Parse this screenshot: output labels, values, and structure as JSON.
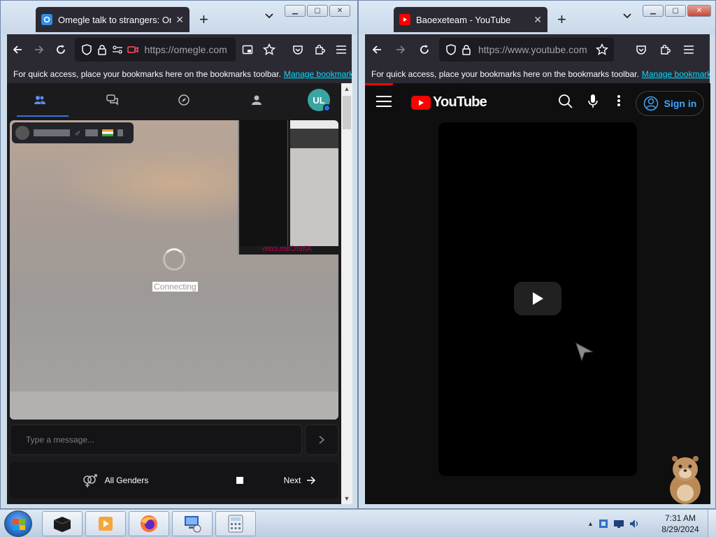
{
  "left_window": {
    "tab_title": "Omegle talk to strangers: Omegle",
    "url": "https://omegle.com",
    "bookmarks_text": "For quick access, place your bookmarks here on the bookmarks toolbar.",
    "manage_bookmarks": "Manage bookmarks",
    "omegle": {
      "avatar_initials": "UL",
      "connecting_text": "Connecting",
      "pip_watermark": "AlterCam.com",
      "message_placeholder": "Type a message...",
      "gender_label": "All Genders",
      "next_label": "Next"
    }
  },
  "right_window": {
    "tab_title": "Baoexeteam - YouTube",
    "url": "https://www.youtube.com",
    "bookmarks_text": "For quick access, place your bookmarks here on the bookmarks toolbar.",
    "manage_bookmarks": "Manage bookmarks",
    "youtube": {
      "logo_text": "YouTube",
      "sign_in": "Sign in"
    }
  },
  "taskbar": {
    "time": "7:31 AM",
    "date": "8/29/2024"
  },
  "colors": {
    "firefox_chrome": "#2b2a33",
    "youtube_red": "#ff0000",
    "youtube_link_blue": "#3ea6ff",
    "omegle_accent": "#3d6fd9"
  }
}
